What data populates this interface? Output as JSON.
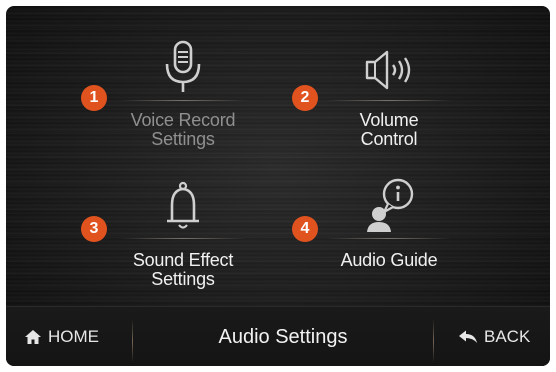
{
  "tiles": [
    {
      "number": "1",
      "label": "Voice Record\nSettings",
      "icon": "microphone-icon",
      "label_color": "#8f8f8f"
    },
    {
      "number": "2",
      "label": "Volume\nControl",
      "icon": "speaker-volume-icon",
      "label_color": "#f0f0f0"
    },
    {
      "number": "3",
      "label": "Sound Effect\nSettings",
      "icon": "bell-icon",
      "label_color": "#f0f0f0"
    },
    {
      "number": "4",
      "label": "Audio Guide",
      "icon": "person-info-icon",
      "label_color": "#f0f0f0"
    }
  ],
  "bottom_bar": {
    "home_label": "HOME",
    "title": "Audio Settings",
    "back_label": "BACK"
  },
  "colors": {
    "badge": "#e0531f",
    "icon": "#d2d2d2",
    "background": "#1b1b1b"
  }
}
